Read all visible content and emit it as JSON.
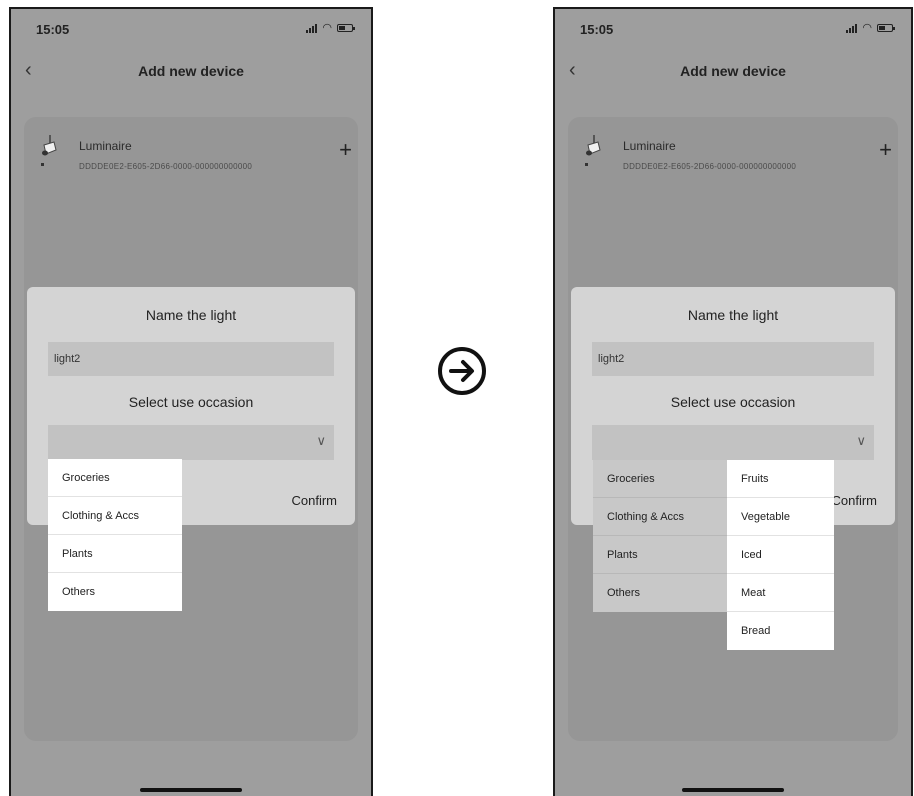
{
  "status": {
    "time": "15:05"
  },
  "nav": {
    "title": "Add new device"
  },
  "device": {
    "name": "Luminaire",
    "id": "DDDDE0E2-E605-2D66-0000-000000000000"
  },
  "dialog": {
    "title": "Name the light",
    "name_value": "light2",
    "occasion_title": "Select use occasion",
    "confirm_label": "Confirm"
  },
  "occasion_menu": [
    "Groceries",
    "Clothing & Accs",
    "Plants",
    "Others"
  ],
  "submenu": [
    "Fruits",
    "Vegetable",
    "Iced",
    "Meat",
    "Bread"
  ],
  "icons": {
    "back": "chevron-left-icon",
    "add": "plus-icon",
    "dropdown": "chevron-down-icon",
    "transition": "arrow-right-circle-icon"
  }
}
